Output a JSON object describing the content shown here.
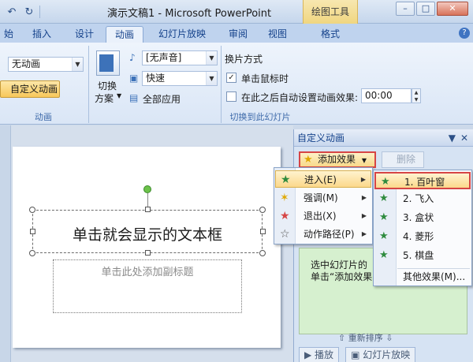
{
  "window": {
    "title": "演示文稿1 - Microsoft PowerPoint",
    "context_tab": "绘图工具",
    "minimize": "–",
    "restore": "□",
    "close": "✕"
  },
  "qat": {
    "undo": "↶",
    "redo": "↻"
  },
  "tabs": [
    "始",
    "插入",
    "设计",
    "动画",
    "幻灯片放映",
    "审阅",
    "视图",
    "格式"
  ],
  "active_tab": "动画",
  "help": "?",
  "ribbon": {
    "animation_group": {
      "preset_value": "无动画",
      "custom_anim_label": "自定义动画",
      "label": "动画"
    },
    "transition_group": {
      "scheme_label_line1": "切换",
      "scheme_label_line2": "方案",
      "sound_value": "[无声音]",
      "speed_value": "快速",
      "apply_all_label": "全部应用",
      "advance_title": "换片方式",
      "on_click_label": "单击鼠标时",
      "on_click_checked": true,
      "auto_label": "在此之后自动设置动画效果:",
      "auto_checked": false,
      "auto_time": "00:00",
      "label": "切换到此幻灯片"
    }
  },
  "slide": {
    "title_text": "单击就会显示的文本框",
    "subtitle_placeholder": "单击此处添加副标题"
  },
  "taskpane": {
    "title": "自定义动画",
    "add_effect_label": "添加效果",
    "remove_label": "删除",
    "hint_text": "选中幻灯片的某个元素，然后单击“添加效果”",
    "hint_visible_line1": "选中幻灯片的",
    "hint_visible_line2": "单击“添加效果",
    "reorder_label": "重新排序",
    "play_label": "播放",
    "slideshow_label": "幻灯片放映"
  },
  "effect_menu": [
    {
      "label": "进入(E)",
      "icon": "entrance-star-icon",
      "color": "#2e8b3e"
    },
    {
      "label": "强调(M)",
      "icon": "emphasis-star-icon",
      "color": "#e0a800"
    },
    {
      "label": "退出(X)",
      "icon": "exit-star-icon",
      "color": "#d64545"
    },
    {
      "label": "动作路径(P)",
      "icon": "motion-path-star-icon",
      "color": "#555555"
    }
  ],
  "entrance_menu": [
    {
      "label": "1. 百叶窗"
    },
    {
      "label": "2. 飞入"
    },
    {
      "label": "3. 盒状"
    },
    {
      "label": "4. 菱形"
    },
    {
      "label": "5. 棋盘"
    },
    {
      "label": "其他效果(M)..."
    }
  ]
}
